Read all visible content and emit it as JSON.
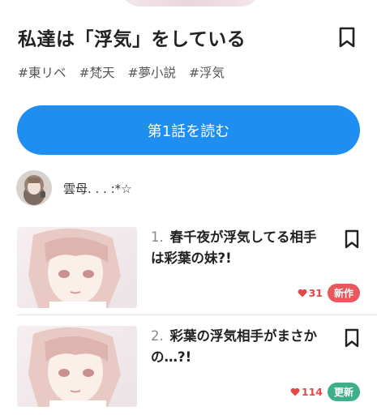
{
  "story": {
    "title": "私達は「浮気」をしている",
    "tags": [
      "#東リベ",
      "#梵天",
      "#夢小説",
      "#浮気"
    ],
    "read_button_label": "第1話を読む",
    "author_name": "雲母. . . :*☆"
  },
  "episodes": [
    {
      "number": "1.",
      "title": "春千夜が浮気してる相手は彩葉の妹?!",
      "likes": "31",
      "badge": "新作",
      "badge_color": "#e8585c"
    },
    {
      "number": "2.",
      "title": "彩葉の浮気相手がまさかの…?!",
      "likes": "114",
      "badge": "更新",
      "badge_color": "#3fae8a"
    }
  ],
  "colors": {
    "accent": "#1f8ef1",
    "heart": "#e0484c"
  }
}
